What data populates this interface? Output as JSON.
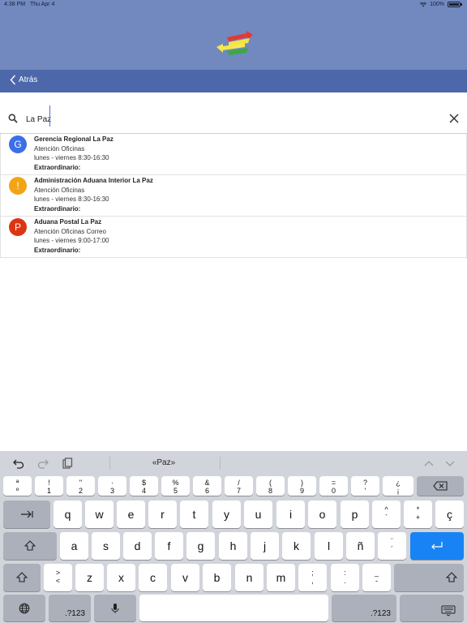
{
  "status_bar": {
    "time": "4:38 PM",
    "date": "Thu Apr 4",
    "battery": "100%"
  },
  "nav": {
    "back_label": "Atrás"
  },
  "search": {
    "value": "La Paz",
    "placeholder": ""
  },
  "results": [
    {
      "initial": "G",
      "color": "#3b6ee8",
      "title": "Gerencia Regional La Paz",
      "line1": "Atención Oficinas",
      "line2": "lunes - viernes 8:30-16:30",
      "extra": "Extraordinario:"
    },
    {
      "initial": "!",
      "color": "#f2a414",
      "title": "Administración Aduana Interior La Paz",
      "line1": "Atención Oficinas",
      "line2": "lunes - viernes 8:30-16:30",
      "extra": "Extraordinario:"
    },
    {
      "initial": "P",
      "color": "#db3512",
      "title": "Aduana Postal La Paz",
      "line1": "Atención Oficinas Correo",
      "line2": "lunes - viernes 9:00-17:00",
      "extra": "Extraordinario:"
    }
  ],
  "keyboard": {
    "suggestion": "«Paz»",
    "number_row": [
      {
        "top": "ª",
        "bottom": "º"
      },
      {
        "top": "!",
        "bottom": "1"
      },
      {
        "top": "\"",
        "bottom": "2"
      },
      {
        "top": "·",
        "bottom": "3"
      },
      {
        "top": "$",
        "bottom": "4"
      },
      {
        "top": "%",
        "bottom": "5"
      },
      {
        "top": "&",
        "bottom": "6"
      },
      {
        "top": "/",
        "bottom": "7"
      },
      {
        "top": "(",
        "bottom": "8"
      },
      {
        "top": ")",
        "bottom": "9"
      },
      {
        "top": "=",
        "bottom": "0"
      },
      {
        "top": "?",
        "bottom": "'"
      },
      {
        "top": "¿",
        "bottom": "¡"
      }
    ],
    "row_q": [
      "q",
      "w",
      "e",
      "r",
      "t",
      "y",
      "u",
      "i",
      "o",
      "p"
    ],
    "row_q_extra": [
      {
        "top": "^",
        "bottom": "`"
      },
      {
        "top": "*",
        "bottom": "+"
      }
    ],
    "row_q_last": "ç",
    "row_a": [
      "a",
      "s",
      "d",
      "f",
      "g",
      "h",
      "j",
      "k",
      "l",
      "ñ"
    ],
    "row_a_extra": {
      "top": "¨",
      "bottom": "´"
    },
    "row_z_first": {
      "top": ">",
      "bottom": "<"
    },
    "row_z": [
      "z",
      "x",
      "c",
      "v",
      "b",
      "n",
      "m"
    ],
    "row_z_extra": [
      {
        "top": ";",
        "bottom": ","
      },
      {
        "top": ":",
        "bottom": "."
      },
      {
        "top": "_",
        "bottom": "-"
      }
    ],
    "numbers_label": ".?123",
    "numbers_label_right": ".?123"
  }
}
